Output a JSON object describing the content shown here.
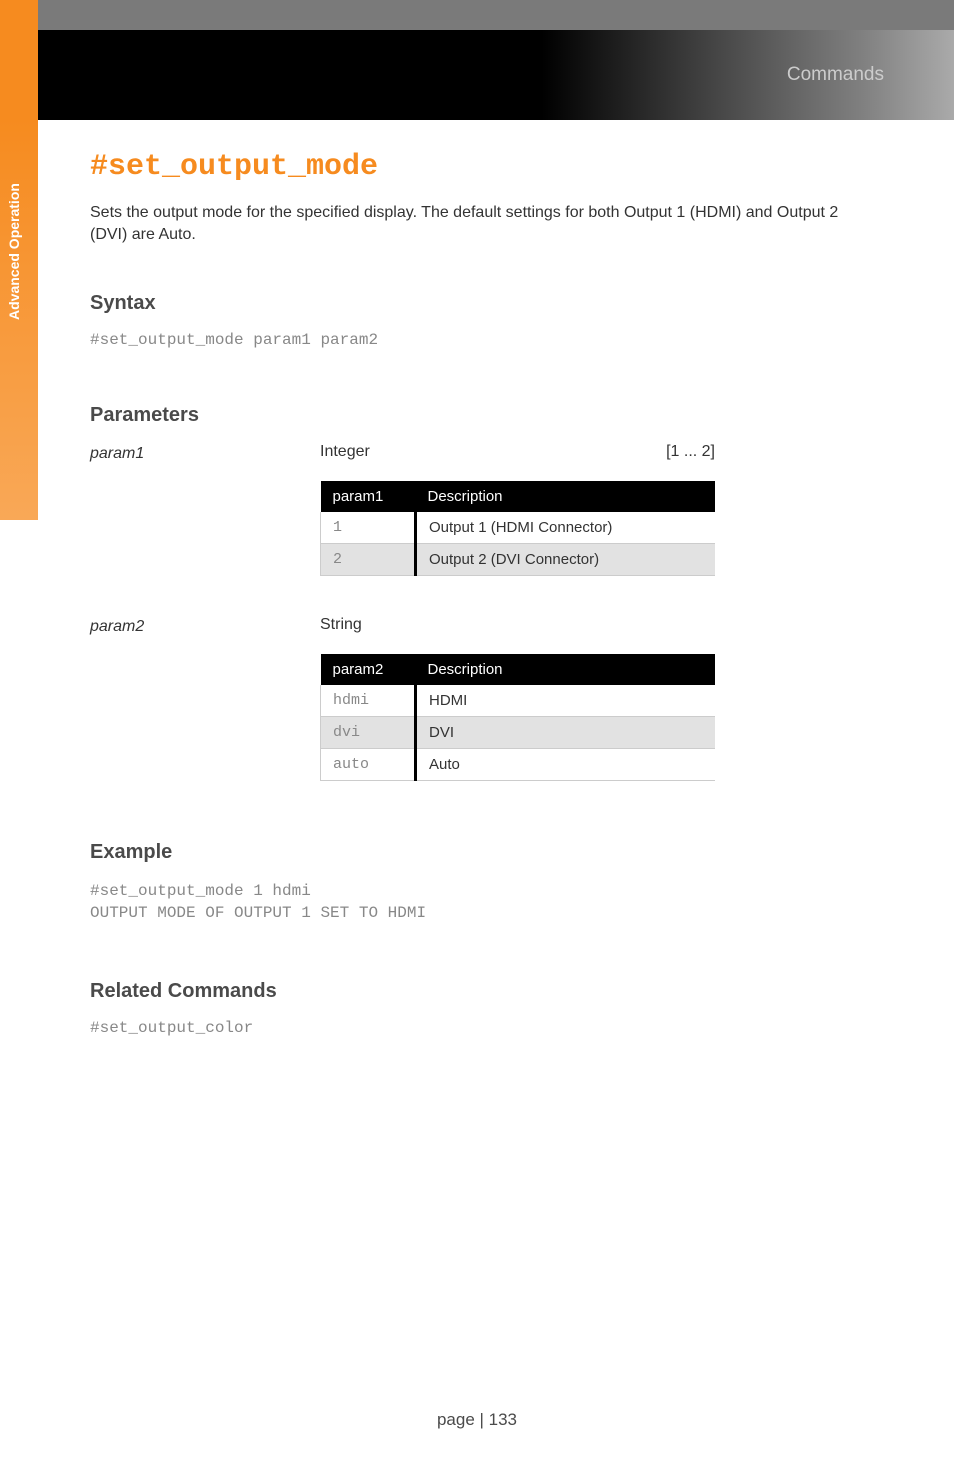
{
  "header": {
    "title": "Commands",
    "sidebar_label": "Advanced Operation"
  },
  "command": {
    "name": "#set_output_mode",
    "description": "Sets the output mode for the specified display.  The default settings for both Output 1 (HDMI) and Output 2 (DVI) are Auto."
  },
  "syntax": {
    "heading": "Syntax",
    "code": "#set_output_mode param1 param2"
  },
  "parameters": {
    "heading": "Parameters",
    "param1": {
      "label": "param1",
      "type": "Integer",
      "range": "[1 ... 2]",
      "table_header_col1": "param1",
      "table_header_col2": "Description",
      "rows": [
        {
          "val": "1",
          "desc": "Output 1 (HDMI Connector)"
        },
        {
          "val": "2",
          "desc": "Output 2 (DVI Connector)"
        }
      ]
    },
    "param2": {
      "label": "param2",
      "type": "String",
      "table_header_col1": "param2",
      "table_header_col2": "Description",
      "rows": [
        {
          "val": "hdmi",
          "desc": "HDMI"
        },
        {
          "val": "dvi",
          "desc": "DVI"
        },
        {
          "val": "auto",
          "desc": "Auto"
        }
      ]
    }
  },
  "example": {
    "heading": "Example",
    "code": "#set_output_mode 1 hdmi\nOUTPUT MODE OF OUTPUT 1 SET TO HDMI"
  },
  "related": {
    "heading": "Related Commands",
    "items": [
      "#set_output_color"
    ]
  },
  "page_number": "page | 133"
}
